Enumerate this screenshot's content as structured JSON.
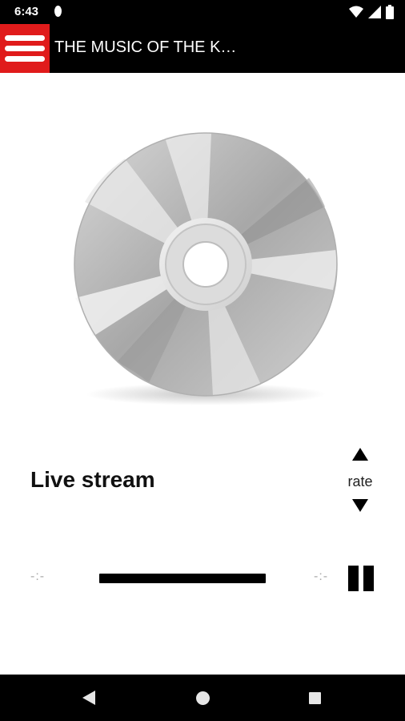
{
  "status_bar": {
    "time": "6:43",
    "icons": [
      "notification-dot-icon",
      "wifi-icon",
      "signal-icon",
      "battery-icon"
    ]
  },
  "app_bar": {
    "menu_icon": "hamburger-menu-icon",
    "title": "THE MUSIC OF THE K…",
    "accent_color": "#e01b1b"
  },
  "player": {
    "artwork": "cd-disc",
    "track_title": "Live stream",
    "rate_label": "rate",
    "time_elapsed": "-:-",
    "time_remaining": "-:-",
    "state": "playing",
    "pause_icon": "pause-icon"
  },
  "nav_bar": {
    "back": "back-icon",
    "home": "home-icon",
    "recents": "recents-icon"
  }
}
